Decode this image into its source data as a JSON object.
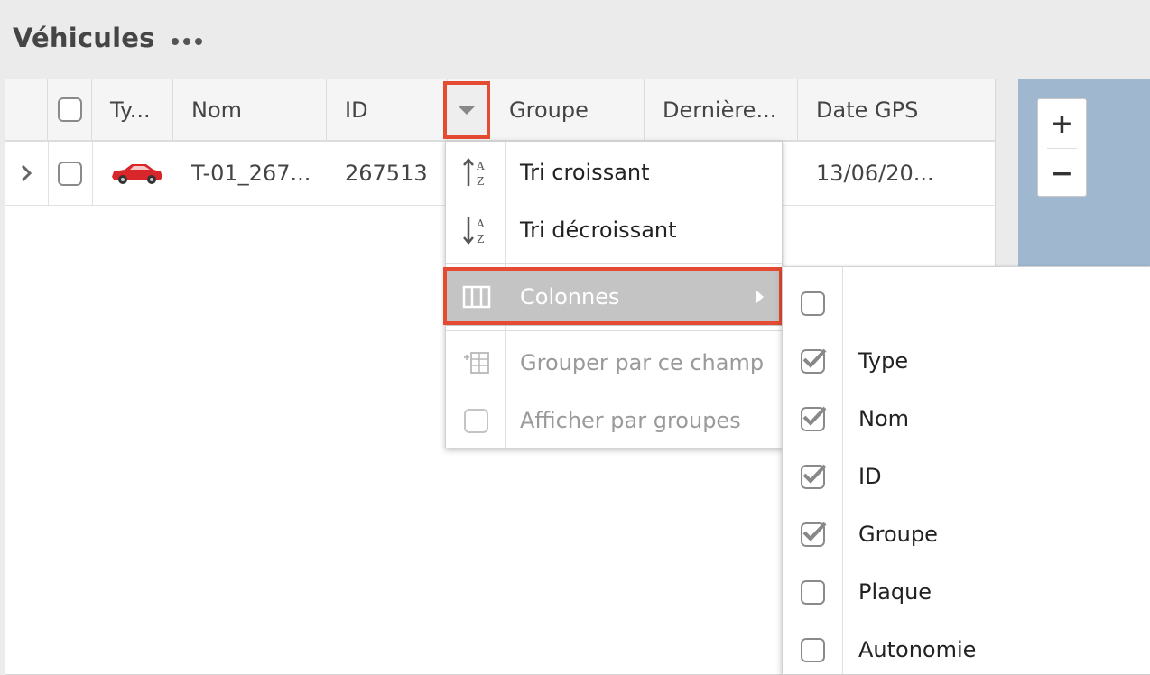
{
  "page": {
    "title": "Véhicules"
  },
  "grid": {
    "columns": [
      "Ty...",
      "Nom",
      "ID",
      "Groupe",
      "Dernière...",
      "Date GPS"
    ],
    "rows": [
      {
        "name": "T-01_267...",
        "id": "267513",
        "date_gps": "13/06/20..."
      }
    ]
  },
  "map": {
    "zoom_in": "+",
    "zoom_out": "−"
  },
  "context_menu": {
    "sort_asc": "Tri croissant",
    "sort_desc": "Tri décroissant",
    "columns": "Colonnes",
    "group_by": "Grouper par ce champ",
    "show_groups": "Afficher par groupes",
    "sort_icon_letters": {
      "top": "A",
      "bottom": "Z"
    }
  },
  "columns_submenu": [
    {
      "label": "",
      "checked": false
    },
    {
      "label": "Type",
      "checked": true
    },
    {
      "label": "Nom",
      "checked": true
    },
    {
      "label": "ID",
      "checked": true
    },
    {
      "label": "Groupe",
      "checked": true
    },
    {
      "label": "Plaque",
      "checked": false
    },
    {
      "label": "Autonomie",
      "checked": false
    }
  ],
  "colors": {
    "highlight": "#e44b32",
    "car": "#d9262b",
    "map_background": "#9fb8d0",
    "menu_active": "#c4c4c4"
  }
}
